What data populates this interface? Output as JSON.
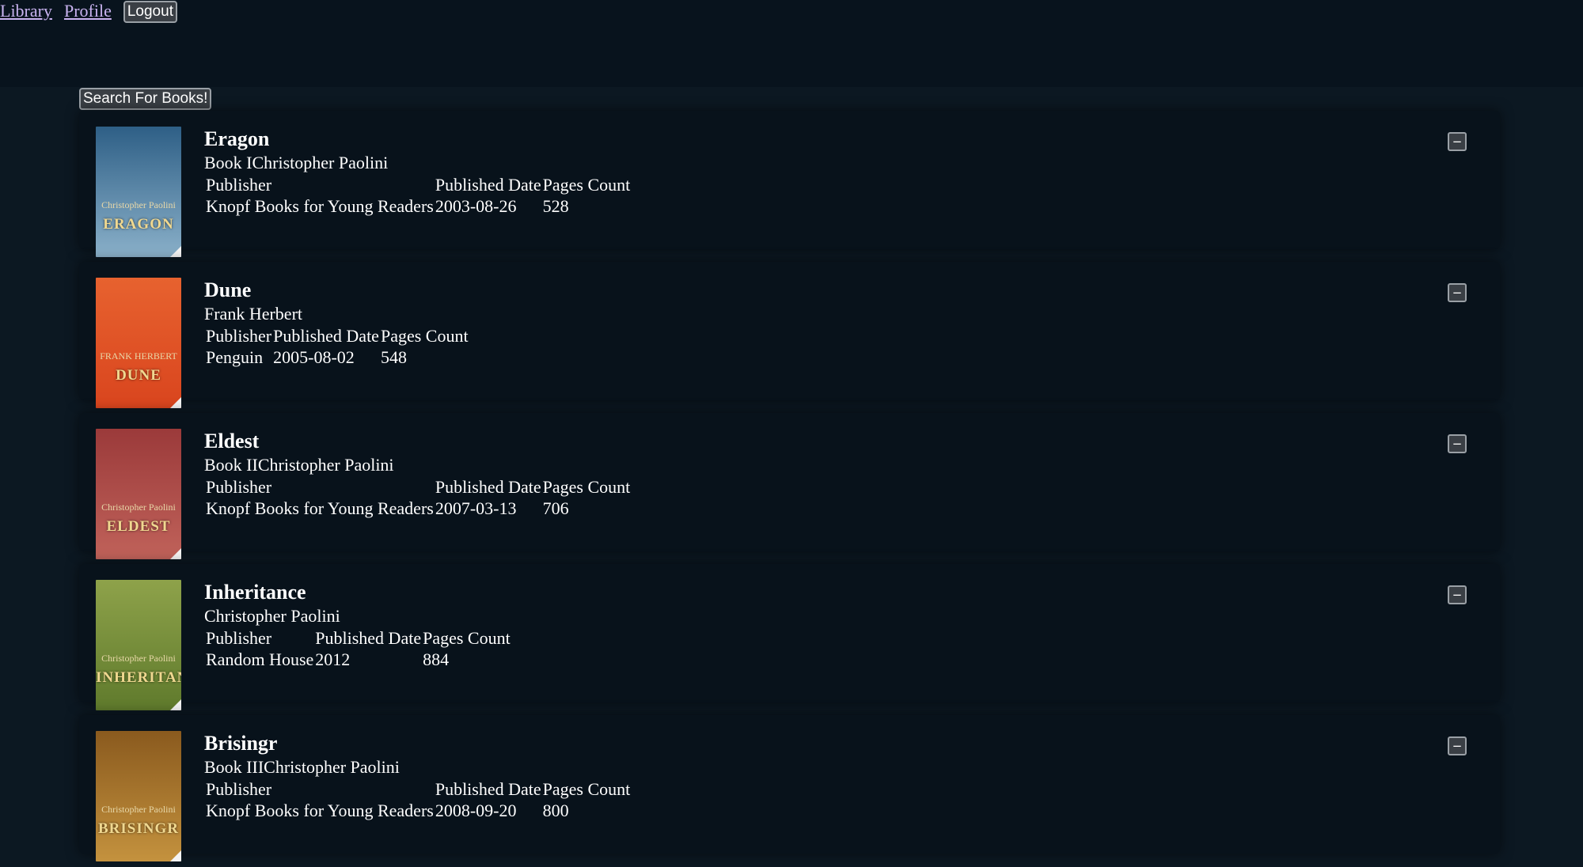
{
  "nav": {
    "library": "Library",
    "profile": "Profile",
    "logout": "Logout"
  },
  "search_button": "Search For Books!",
  "table_headers": {
    "publisher": "Publisher",
    "published_date": "Published Date",
    "pages_count": "Pages Count"
  },
  "remove_icon": "−",
  "books": [
    {
      "title": "Eragon",
      "subtitle": "Book IChristopher Paolini",
      "publisher": "Knopf Books for Young Readers",
      "published_date": "2003-08-26",
      "pages_count": "528",
      "cover": {
        "icon": "book-cover-eragon",
        "color_top": "#2e5f86",
        "color_bottom": "#8ab0c9",
        "cover_title": "ERAGON",
        "cover_author": "Christopher Paolini"
      }
    },
    {
      "title": "Dune",
      "subtitle": "Frank Herbert",
      "publisher": "Penguin",
      "published_date": "2005-08-02",
      "pages_count": "548",
      "cover": {
        "icon": "book-cover-dune",
        "color_top": "#e7622f",
        "color_bottom": "#d9451e",
        "cover_title": "DUNE",
        "cover_author": "FRANK HERBERT"
      }
    },
    {
      "title": "Eldest",
      "subtitle": "Book IIChristopher Paolini",
      "publisher": "Knopf Books for Young Readers",
      "published_date": "2007-03-13",
      "pages_count": "706",
      "cover": {
        "icon": "book-cover-eldest",
        "color_top": "#9b3a3a",
        "color_bottom": "#c0625a",
        "cover_title": "ELDEST",
        "cover_author": "Christopher Paolini"
      }
    },
    {
      "title": "Inheritance",
      "subtitle": "Christopher Paolini",
      "publisher": "Random House",
      "published_date": "2012",
      "pages_count": "884",
      "cover": {
        "icon": "book-cover-inheritance",
        "color_top": "#8ea24a",
        "color_bottom": "#5f7a2c",
        "cover_title": "INHERITANCE",
        "cover_author": "Christopher Paolini"
      }
    },
    {
      "title": "Brisingr",
      "subtitle": "Book IIIChristopher Paolini",
      "publisher": "Knopf Books for Young Readers",
      "published_date": "2008-09-20",
      "pages_count": "800",
      "cover": {
        "icon": "book-cover-brisingr",
        "color_top": "#8a5a1e",
        "color_bottom": "#c4923e",
        "cover_title": "BRISINGR",
        "cover_author": "Christopher Paolini"
      }
    }
  ]
}
